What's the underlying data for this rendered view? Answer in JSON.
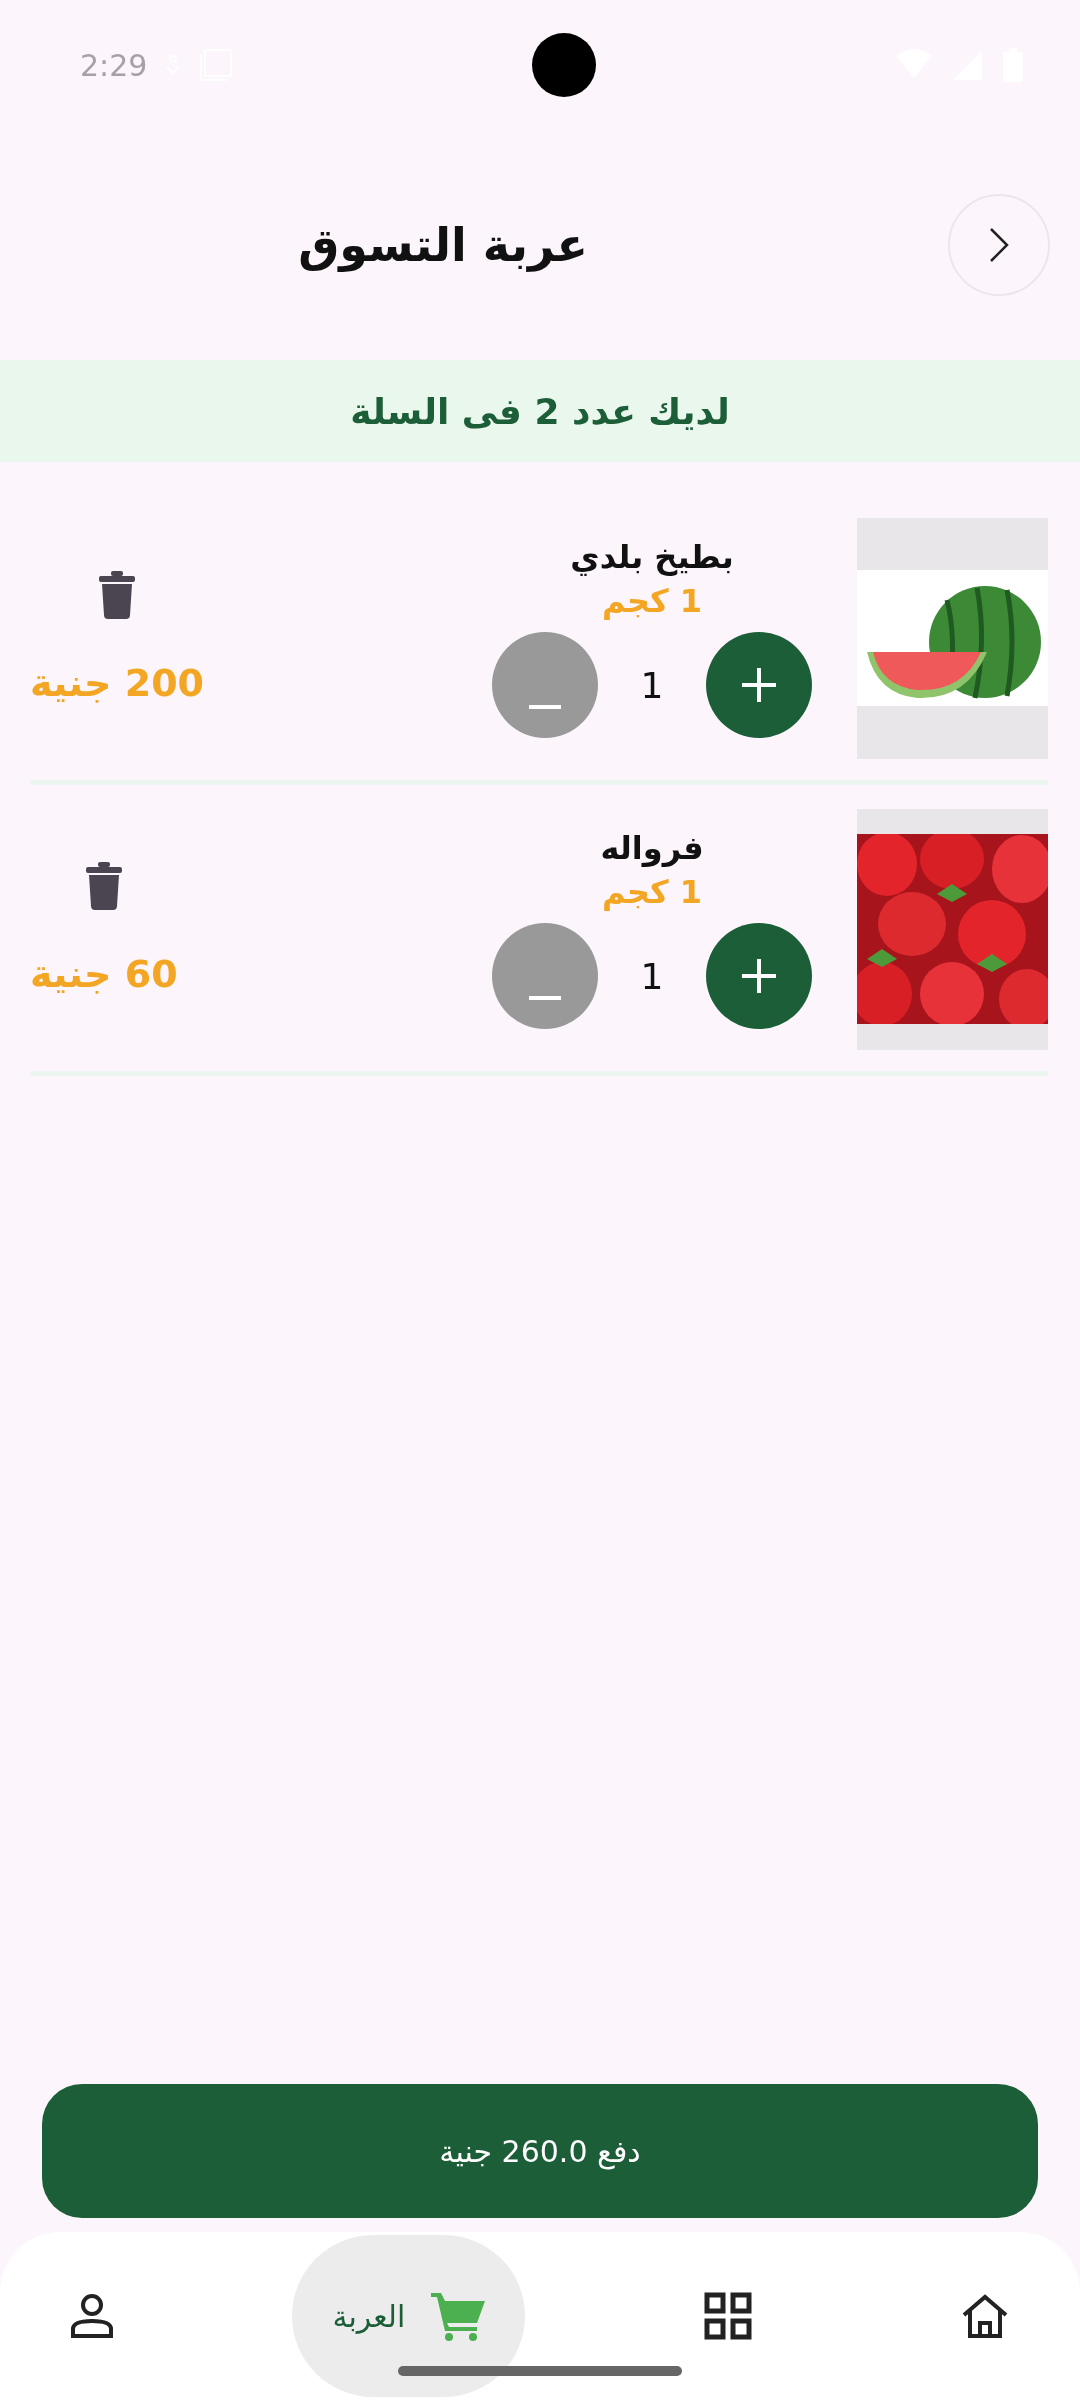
{
  "status_bar": {
    "time": "2:29"
  },
  "header": {
    "title": "عربة التسوق"
  },
  "banner": {
    "text": "لديك عدد 2 فى السلة"
  },
  "items": [
    {
      "name": "بطيخ بلدي",
      "weight": "1 كجم",
      "quantity": "1",
      "price": "200 جنية"
    },
    {
      "name": "فرواله",
      "weight": "1 كجم",
      "quantity": "1",
      "price": "60 جنية"
    }
  ],
  "pay_button": {
    "label": "دفع 260.0 جنية"
  },
  "bottom_nav": [
    {
      "kind": "home",
      "selected": false
    },
    {
      "kind": "grid",
      "selected": false
    },
    {
      "kind": "cart",
      "label": "العربة",
      "selected": true
    },
    {
      "kind": "profile",
      "selected": false
    }
  ]
}
